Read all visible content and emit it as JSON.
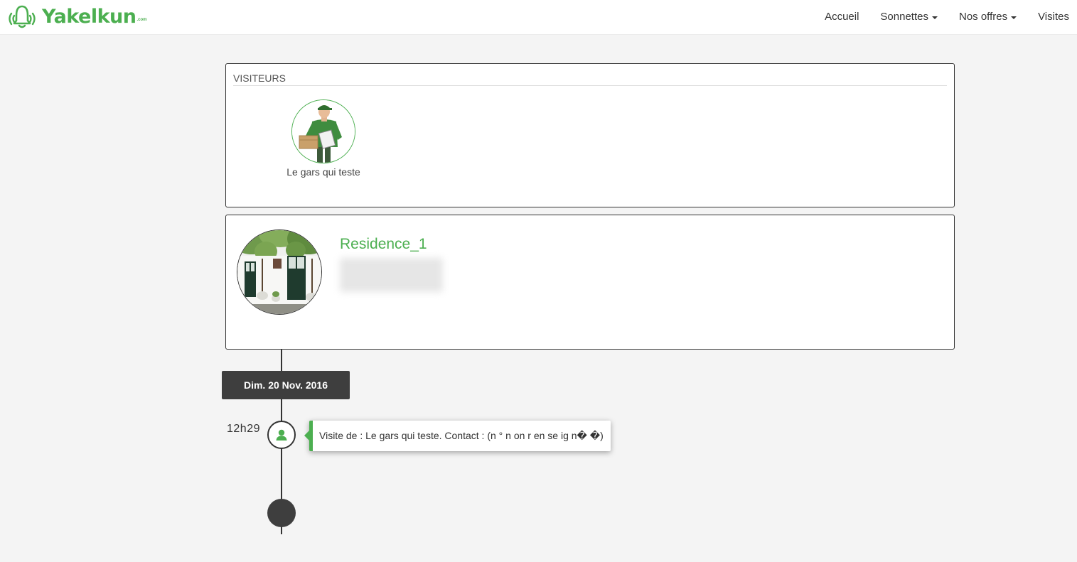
{
  "brand": {
    "name": "Yakelkun",
    "tld": ".com",
    "color": "#4caf50"
  },
  "nav": {
    "items": [
      {
        "label": "Accueil",
        "dropdown": false
      },
      {
        "label": "Sonnettes",
        "dropdown": true
      },
      {
        "label": "Nos offres",
        "dropdown": true
      },
      {
        "label": "Visites",
        "dropdown": false
      }
    ]
  },
  "visitors": {
    "heading": "VISITEURS",
    "items": [
      {
        "name": "Le gars qui teste",
        "avatar": "delivery-man-photo"
      }
    ]
  },
  "residence": {
    "name": "Residence_1",
    "photo": "house-facade-photo"
  },
  "timeline": {
    "date": "Dim. 20 Nov. 2016",
    "events": [
      {
        "time": "12h29",
        "icon": "user-icon",
        "text": "Visite de : Le gars qui teste. Contact : (n ° n on r en se ig n� �)"
      }
    ]
  },
  "colors": {
    "accent": "#4caf50",
    "dark": "#3e3e3e",
    "background": "#f4f4f4"
  }
}
